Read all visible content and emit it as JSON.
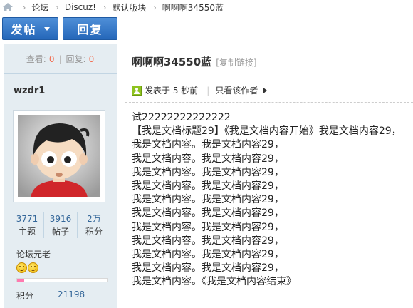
{
  "breadcrumb": {
    "items": [
      "论坛",
      "Discuz!",
      "默认版块",
      "啊啊啊34550蓝"
    ]
  },
  "actions": {
    "post_label": "发帖",
    "reply_label": "回复"
  },
  "sidebar": {
    "views_label": "查看:",
    "views_value": "0",
    "replies_label": "回复:",
    "replies_value": "0",
    "author": "wzdr1",
    "stats": [
      {
        "value": "3771",
        "label": "主题"
      },
      {
        "value": "3916",
        "label": "帖子"
      },
      {
        "value": "2万",
        "label": "积分"
      }
    ],
    "rank": "论坛元老",
    "credits_label": "积分",
    "credits_value": "21198",
    "colors": {
      "accent": "#369",
      "count": "#f26c4f"
    }
  },
  "post": {
    "title": "啊啊啊34550蓝",
    "copy_link": "[复制链接]",
    "posted_at": "发表于 5 秒前",
    "author_only": "只看该作者",
    "lines": [
      "试22222222222222",
      "【我是文档标题29】《我是文档内容开始》我是文档内容29，",
      "我是文档内容。我是文档内容29，",
      "我是文档内容。我是文档内容29，",
      "我是文档内容。我是文档内容29，",
      "我是文档内容。我是文档内容29，",
      "我是文档内容。我是文档内容29，",
      "我是文档内容。我是文档内容29，",
      "我是文档内容。我是文档内容29，",
      "我是文档内容。我是文档内容29，",
      "我是文档内容。我是文档内容29，",
      "我是文档内容。我是文档内容29，",
      "我是文档内容。《我是文档内容结束》"
    ]
  }
}
